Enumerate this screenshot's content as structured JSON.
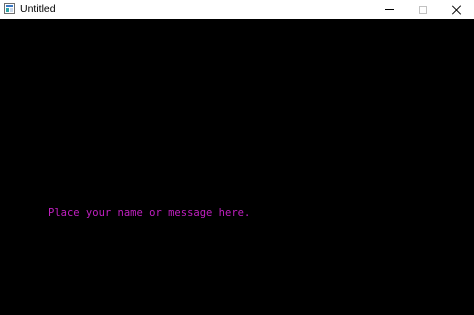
{
  "window": {
    "title": "Untitled",
    "controls": {
      "minimize_icon": "minimize-icon",
      "maximize_icon": "maximize-icon",
      "close_icon": "close-icon"
    }
  },
  "canvas": {
    "background": "#000000",
    "message": "Place your name or message here.",
    "message_color": "#c020c0"
  }
}
